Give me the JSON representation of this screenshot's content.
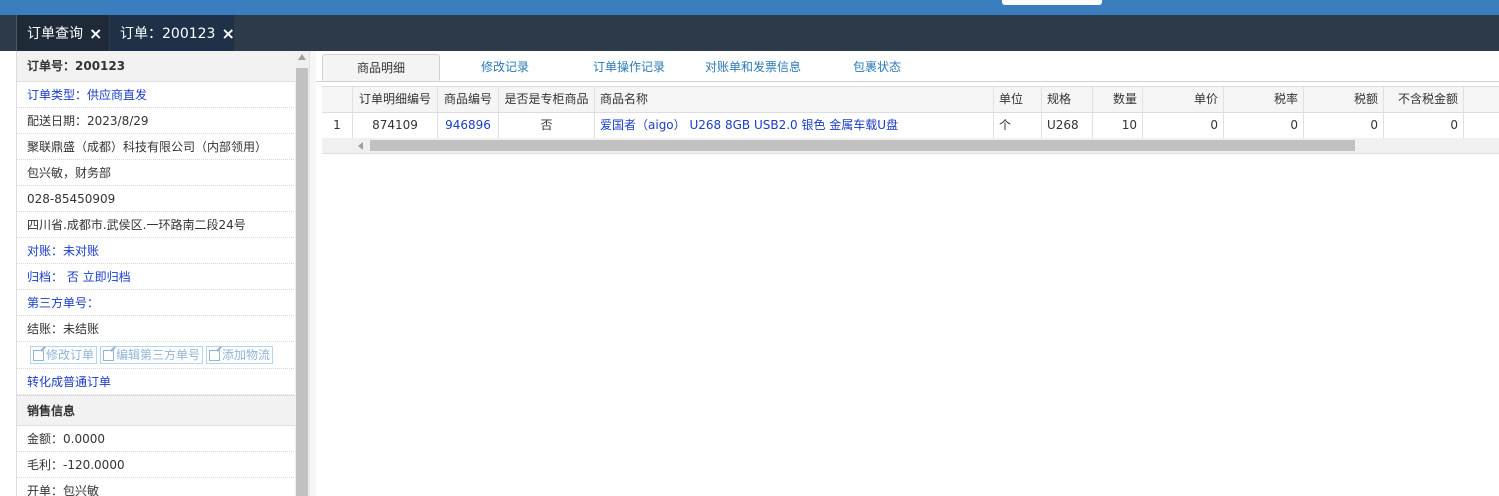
{
  "tabs": [
    {
      "label": "订单查询",
      "close_icon": "×"
    },
    {
      "label": "订单：200123",
      "close_icon": "×"
    }
  ],
  "order_info": {
    "order_no": "订单号：200123",
    "order_type": "订单类型：供应商直发",
    "delivery_date": "配送日期：2023/8/29",
    "company": "聚联鼎盛（成都）科技有限公司（内部领用）",
    "contact": "包兴敏，财务部",
    "phone": "028-85450909",
    "address": "四川省.成都市.武侯区.一环路南二段24号",
    "reconcile": "对账：未对账",
    "archive": "归档：  否 立即归档",
    "third_party_no": "第三方单号：",
    "settlement": "结账：未结账",
    "buttons": {
      "edit_order": "修改订单",
      "edit_third_party": "编辑第三方单号",
      "add_logistics": "添加物流"
    },
    "convert": "转化成普通订单"
  },
  "sales_info": {
    "title": "销售信息",
    "amount": "金额：0.0000",
    "profit": "毛利：-120.0000",
    "creator": "开单：包兴敏"
  },
  "subtabs": [
    "商品明细",
    "修改记录",
    "订单操作记录",
    "对账单和发票信息",
    "包裹状态"
  ],
  "grid": {
    "headers": [
      "",
      "订单明细编号",
      "商品编号",
      "是否是专柜商品",
      "商品名称",
      "单位",
      "规格",
      "数量",
      "单价",
      "税率",
      "税额",
      "不含税金额",
      ""
    ],
    "rows": [
      [
        "1",
        "874109",
        "946896",
        "否",
        "爱国者（aigo） U268 8GB USB2.0 银色 金属车载U盘",
        "个",
        "U268",
        "10",
        "0",
        "0",
        "0",
        "0",
        ""
      ]
    ]
  },
  "colors": {
    "topbar": "#3a7ebf",
    "tabbar": "#2d3a48",
    "link": "#1a3dc8"
  }
}
